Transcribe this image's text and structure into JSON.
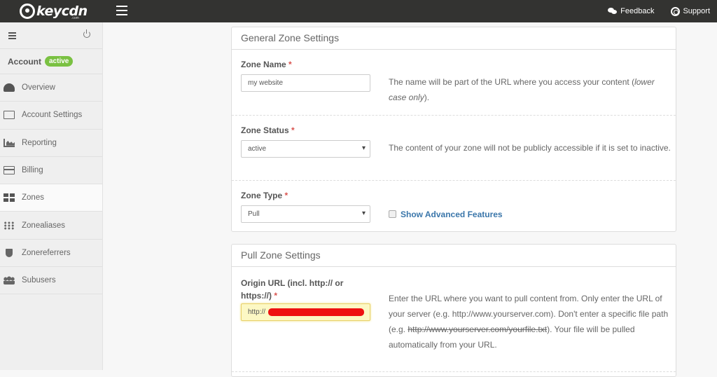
{
  "topbar": {
    "brand": "keycdn",
    "brand_suffix": ".com",
    "links": [
      {
        "label": "Feedback",
        "icon": "comments-icon"
      },
      {
        "label": "Support",
        "icon": "lifebuoy-icon"
      }
    ]
  },
  "sidebar": {
    "account_label": "Account",
    "account_status": "active",
    "items": [
      {
        "label": "Overview",
        "icon": "dashboard-icon"
      },
      {
        "label": "Account Settings",
        "icon": "edit-icon"
      },
      {
        "label": "Reporting",
        "icon": "area-chart-icon"
      },
      {
        "label": "Billing",
        "icon": "credit-card-icon"
      },
      {
        "label": "Zones",
        "icon": "grid-icon",
        "active": true
      },
      {
        "label": "Zonealiases",
        "icon": "grid-dots-icon"
      },
      {
        "label": "Zonereferrers",
        "icon": "shield-icon"
      },
      {
        "label": "Subusers",
        "icon": "users-icon"
      }
    ]
  },
  "general": {
    "title": "General Zone Settings",
    "zone_name": {
      "label": "Zone Name",
      "required": "*",
      "value": "my website",
      "help": "The name will be part of the URL where you access your content (",
      "help_em": "lower case only",
      "help_end": ")."
    },
    "zone_status": {
      "label": "Zone Status",
      "required": "*",
      "value": "active",
      "help": "The content of your zone will not be publicly accessible if it is set to inactive."
    },
    "zone_type": {
      "label": "Zone Type",
      "required": "*",
      "value": "Pull",
      "advanced_label": "Show Advanced Features",
      "advanced_checked": false
    }
  },
  "pull": {
    "title": "Pull Zone Settings",
    "origin": {
      "label": "Origin URL (incl. http:// or https://)",
      "required": "*",
      "value": "http://",
      "help_1": "Enter the URL where you want to pull content from. Only enter the URL of your server (e.g. http://www.yourserver.com). Don't enter a specific file path (e.g. ",
      "help_strike": "http://www.yourserver.com/yourfile.txt",
      "help_2": "). Your file will be pulled automatically from your URL."
    }
  }
}
